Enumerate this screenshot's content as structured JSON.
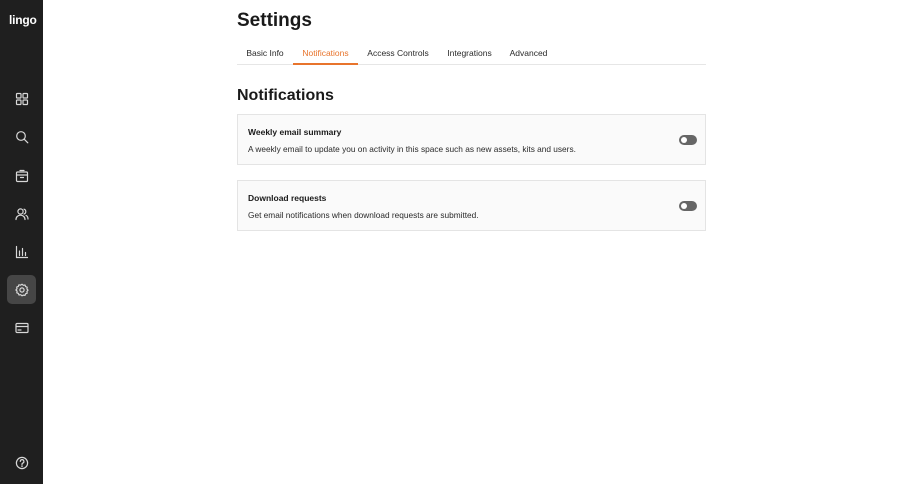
{
  "app": {
    "logo": "lingo"
  },
  "sidebar": {
    "items": [
      {
        "name": "dashboard",
        "icon": "grid-icon",
        "active": false
      },
      {
        "name": "search",
        "icon": "search-icon",
        "active": false
      },
      {
        "name": "kits",
        "icon": "box-icon",
        "active": false
      },
      {
        "name": "users",
        "icon": "users-icon",
        "active": false
      },
      {
        "name": "analytics",
        "icon": "bar-chart-icon",
        "active": false
      },
      {
        "name": "settings",
        "icon": "gear-icon",
        "active": true
      },
      {
        "name": "billing",
        "icon": "credit-card-icon",
        "active": false
      },
      {
        "name": "help",
        "icon": "help-circle-icon",
        "active": false
      }
    ]
  },
  "header": {
    "title": "Settings"
  },
  "tabs": [
    {
      "label": "Basic Info",
      "active": false
    },
    {
      "label": "Notifications",
      "active": true
    },
    {
      "label": "Access Controls",
      "active": false
    },
    {
      "label": "Integrations",
      "active": false
    },
    {
      "label": "Advanced",
      "active": false
    }
  ],
  "section": {
    "title": "Notifications"
  },
  "notifications": [
    {
      "title": "Weekly email summary",
      "description": "A weekly email to update you on activity in this space such as new assets, kits and users.",
      "enabled": false
    },
    {
      "title": "Download requests",
      "description": "Get email notifications when download requests are submitted.",
      "enabled": false
    }
  ],
  "colors": {
    "sidebar_bg": "#1f1f1f",
    "accent": "#e8742c",
    "toggle_off": "#666666"
  }
}
